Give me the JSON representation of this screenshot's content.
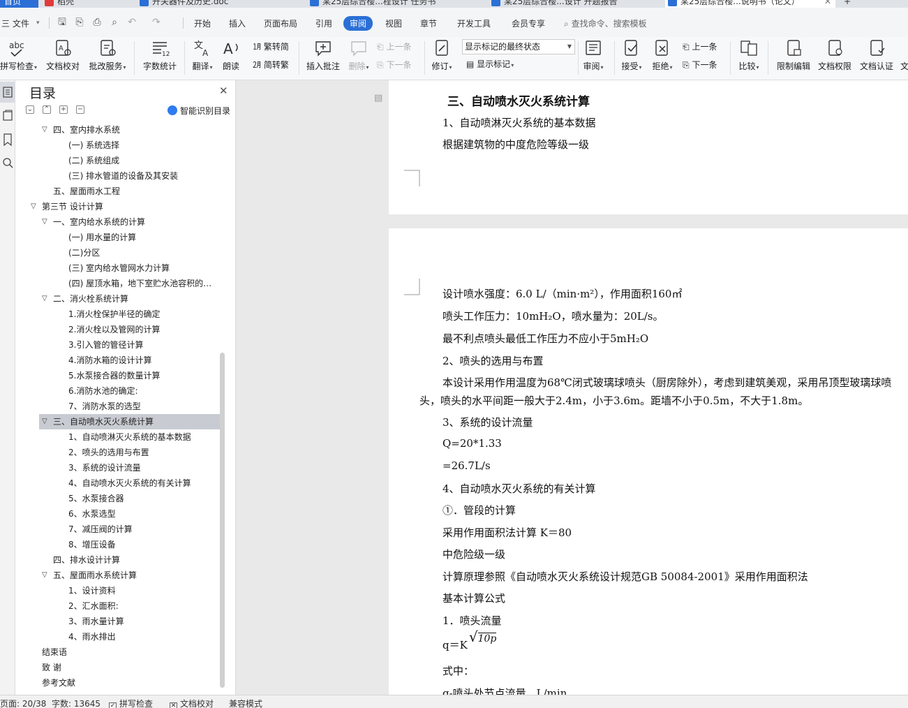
{
  "tabs": [
    {
      "label": "首页",
      "kind": "home"
    },
    {
      "label": "稻壳",
      "kind": "docer"
    },
    {
      "label": "开关器件及历史.doc",
      "kind": "doc"
    },
    {
      "label": "某25层综合楼...程设计 任务书",
      "kind": "doc"
    },
    {
      "label": "某25层综合楼...设计 开题报告",
      "kind": "doc"
    },
    {
      "label": "某25层综合楼...说明书（论文）",
      "kind": "doc",
      "active": true
    }
  ],
  "menu": {
    "file": "三 文件",
    "items": [
      "开始",
      "插入",
      "页面布局",
      "引用",
      "审阅",
      "视图",
      "章节",
      "开发工具",
      "会员专享"
    ],
    "selected": "审阅",
    "search": "查找命令、搜索模板"
  },
  "ribbon": {
    "spellcheck": "拼写检查",
    "doc_proof": "文档校对",
    "annotate": "批改服务",
    "wordcount": "字数统计",
    "translate": "翻译",
    "read_aloud": "朗读",
    "trad": "繁转简",
    "simp": "简转繁",
    "insert_comment": "插入批注",
    "delete": "删除",
    "prev_comment": "上一条",
    "next_comment": "下一条",
    "revise": "修订",
    "markup_select": "显示标记的最终状态",
    "show_markup": "显示标记",
    "review": "审阅",
    "accept": "接受",
    "reject": "拒绝",
    "prev_change": "上一条",
    "next_change": "下一条",
    "compare": "比较",
    "restrict": "限制编辑",
    "permissions": "文档权限",
    "certify": "文档认证",
    "more": "文"
  },
  "nav": {
    "title": "目录",
    "smart_label": "智能识别目录",
    "items": [
      {
        "text": "四、室内排水系统",
        "level": 2,
        "caret": "v"
      },
      {
        "text": "(一) 系统选择",
        "level": 3
      },
      {
        "text": "(二) 系统组成",
        "level": 3
      },
      {
        "text": "(三) 排水管道的设备及其安装",
        "level": 3
      },
      {
        "text": "五、屋面雨水工程",
        "level": 2
      },
      {
        "text": "第三节  设计计算",
        "level": 1,
        "caret": "v"
      },
      {
        "text": "一、室内给水系统的计算",
        "level": 2,
        "caret": "v"
      },
      {
        "text": "(一) 用水量的计算",
        "level": 3
      },
      {
        "text": "(二)分区",
        "level": 3
      },
      {
        "text": "(三) 室内给水管网水力计算",
        "level": 3
      },
      {
        "text": "(四) 屋顶水箱，地下室贮水池容积的…",
        "level": 3
      },
      {
        "text": "二、消火栓系统计算",
        "level": 2,
        "caret": "v"
      },
      {
        "text": "1.消火栓保护半径的确定",
        "level": 3
      },
      {
        "text": "2.消火栓以及管网的计算",
        "level": 3
      },
      {
        "text": "3.引入管的管径计算",
        "level": 3
      },
      {
        "text": "4.消防水箱的设计计算",
        "level": 3
      },
      {
        "text": "5.水泵接合器的数量计算",
        "level": 3
      },
      {
        "text": "6.消防水池的确定:",
        "level": 3
      },
      {
        "text": "7、消防水泵的选型",
        "level": 3
      },
      {
        "text": "三、自动喷水灭火系统计算",
        "level": 2,
        "caret": "v",
        "selected": true
      },
      {
        "text": "1、自动喷淋灭火系统的基本数据",
        "level": 3
      },
      {
        "text": "2、喷头的选用与布置",
        "level": 3
      },
      {
        "text": "3、系统的设计流量",
        "level": 3
      },
      {
        "text": "4、自动喷水灭火系统的有关计算",
        "level": 3
      },
      {
        "text": "5、水泵接合器",
        "level": 3
      },
      {
        "text": "6、水泵选型",
        "level": 3
      },
      {
        "text": "7、减压阀的计算",
        "level": 3
      },
      {
        "text": "8、增压设备",
        "level": 3
      },
      {
        "text": "四、排水设计计算",
        "level": 2
      },
      {
        "text": "五、屋面雨水系统计算",
        "level": 2,
        "caret": "v"
      },
      {
        "text": "1、设计资料",
        "level": 3
      },
      {
        "text": "2、汇水面积:",
        "level": 3
      },
      {
        "text": "3、雨水量计算",
        "level": 3
      },
      {
        "text": "4、雨水排出",
        "level": 3
      },
      {
        "text": "结束语",
        "level": 1
      },
      {
        "text": "致  谢",
        "level": 1
      },
      {
        "text": "参考文献",
        "level": 1
      }
    ]
  },
  "document": {
    "page1": [
      {
        "text": "三、自动喷水灭火系统计算",
        "kind": "title"
      },
      {
        "text": "1、自动喷淋灭火系统的基本数据"
      },
      {
        "text": "根据建筑物的中度危险等级一级"
      }
    ],
    "page2": [
      {
        "text": "设计喷水强度：6.0 L/（min·m²），作用面积160㎡"
      },
      {
        "text": "喷头工作压力：10mH₂O，喷水量为：20L/s。"
      },
      {
        "text": "最不利点喷头最低工作压力不应小于5mH₂O"
      },
      {
        "text": "2、喷头的选用与布置"
      },
      {
        "text": "本设计采用作用温度为68℃闭式玻璃球喷头（厨房除外），考虑到建筑美观，采用吊顶型玻璃球喷"
      },
      {
        "text": "头，喷头的水平间距一般大于2.4m，小于3.6m。距墙不小于0.5m，不大于1.8m。",
        "indent": "hanging"
      },
      {
        "text": "3、系统的设计流量"
      },
      {
        "text": "Q=20*1.33"
      },
      {
        "text": " =26.7L/s"
      },
      {
        "text": "4、自动喷水灭火系统的有关计算"
      },
      {
        "text": "①．管段的计算"
      },
      {
        "text": "采用作用面积法计算  K＝80"
      },
      {
        "text": "中危险级一级"
      },
      {
        "text": "计算原理参照《自动喷水灭火系统设计规范GB 50084-2001》采用作用面积法"
      },
      {
        "text": "基本计算公式"
      },
      {
        "text": "1．喷头流量"
      },
      {
        "text": "q＝K",
        "kind": "formula",
        "sqrt": "10p"
      },
      {
        "text": "式中："
      },
      {
        "text": "q-喷头处节点流量，L/min"
      }
    ]
  },
  "status": {
    "page": "页面: 20/38",
    "words": "字数: 13645",
    "spell": "拼写检查",
    "proof": "文档校对",
    "compat": "兼容模式"
  },
  "colors": {
    "accent": "#2b6fd6",
    "selected_row": "#c8ccd2"
  }
}
